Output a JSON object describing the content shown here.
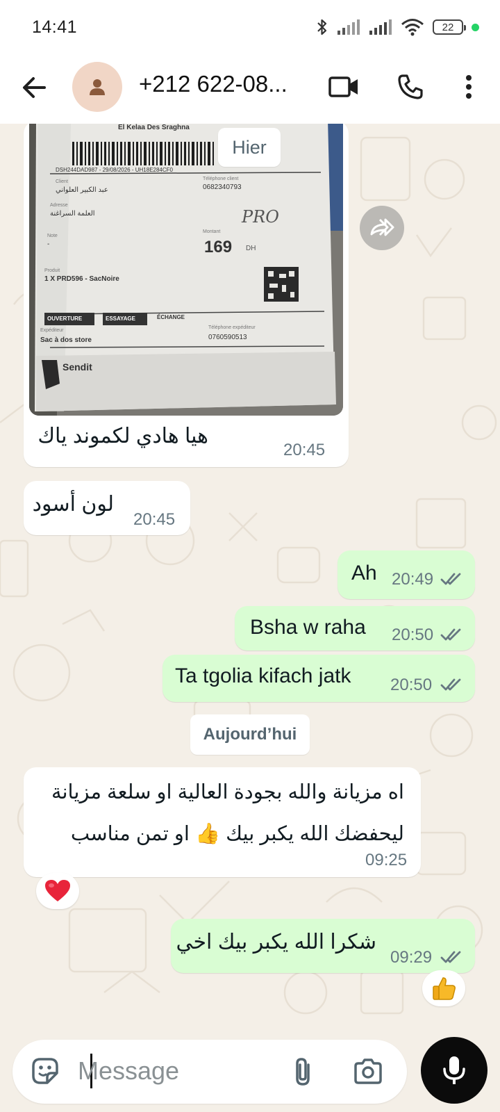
{
  "status_bar": {
    "time": "14:41",
    "battery": "22"
  },
  "header": {
    "contact_name": "+212 622-08...",
    "icons": [
      "back-arrow-icon",
      "video-call-icon",
      "voice-call-icon",
      "more-options-icon"
    ]
  },
  "chat": {
    "date_dividers": [
      "Hier",
      "Aujourd’hui"
    ],
    "messages": [
      {
        "direction": "incoming",
        "has_image": true,
        "text": "هيا هادي لكموند ياك",
        "time": "20:45"
      },
      {
        "direction": "incoming",
        "text": "لون أسود",
        "time": "20:45"
      },
      {
        "direction": "outgoing",
        "text": "Ah",
        "time": "20:49",
        "status": "read"
      },
      {
        "direction": "outgoing",
        "text": "Bsha w raha",
        "time": "20:50",
        "status": "read"
      },
      {
        "direction": "outgoing",
        "text": "Ta tgolia kifach jatk",
        "time": "20:50",
        "status": "read"
      },
      {
        "direction": "incoming",
        "text_line_1": "اه مزيانة والله بجودة العالية او سلعة مزيانة",
        "text_line_2": "ليحفضك الله يكبر بيك 👍 او تمن مناسب",
        "time": "09:25",
        "reaction": "❤️"
      },
      {
        "direction": "outgoing",
        "text": "شكرا الله يكبر بيك اخي",
        "time": "09:29",
        "status": "read",
        "reaction": "👍"
      }
    ],
    "photo_label": {
      "city": "El Kelaa Des Sraghna",
      "tracking": "DSH244DAD987 - 29/08/2026 - UH18E284CF0",
      "client_label": "Client",
      "client_name": "عبد الكبير العلواني",
      "phone_label": "Téléphone client",
      "phone": "0682340793",
      "address_label": "Adresse",
      "address": "العلمة السراغنة",
      "note_label": "Note",
      "note": "-",
      "amount_label": "Montant",
      "amount": "169",
      "currency": "DH",
      "handwriting": "PRO",
      "product_label": "Produit",
      "product": "1 X PRD596 - SacNoire",
      "tags": [
        "OUVERTURE",
        "ESSAYAGE",
        "ÉCHANGE"
      ],
      "sender_label": "Expéditeur",
      "sender": "Sac à dos store",
      "sender_phone_label": "Téléphone expéditeur",
      "sender_phone": "0760590513",
      "brand": "Sendit"
    }
  },
  "input": {
    "placeholder": "Message",
    "icons": [
      "sticker-icon",
      "attach-icon",
      "camera-icon",
      "microphone-icon"
    ]
  },
  "colors": {
    "incoming_bubble": "#ffffff",
    "outgoing_bubble": "#d9fdd3",
    "chat_background": "#f4efe7",
    "read_ticks": "#667781",
    "mic_button": "#0b0b0b"
  }
}
